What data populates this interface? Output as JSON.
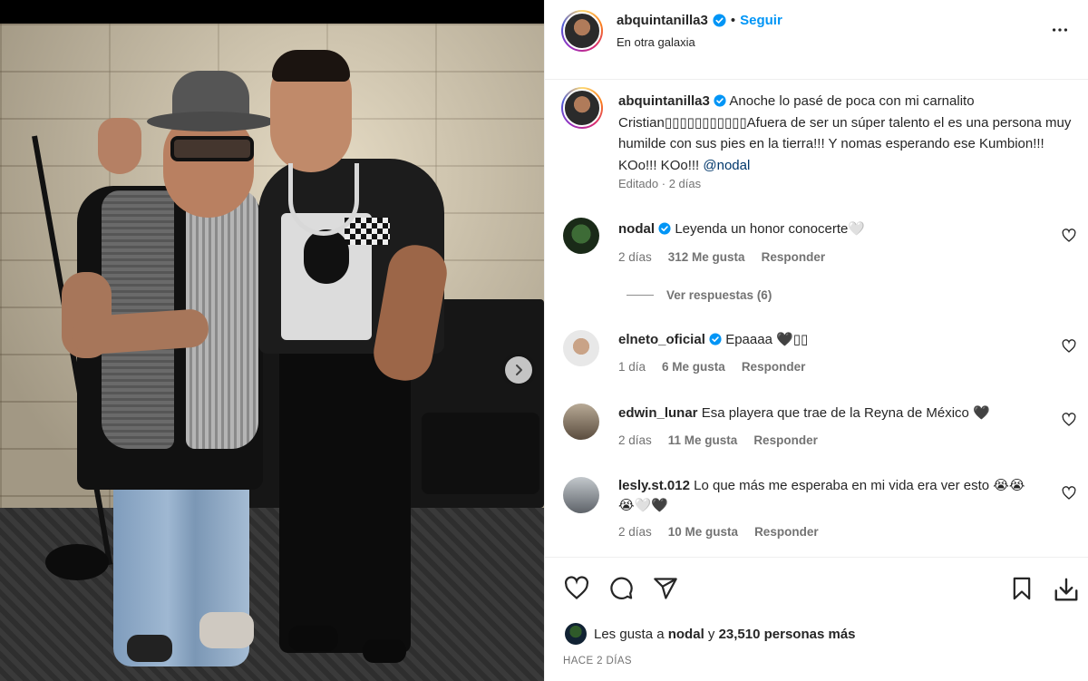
{
  "post": {
    "username": "abquintanilla3",
    "follow_label": "Seguir",
    "separator": "•",
    "location": "En otra galaxia",
    "more_icon": "more-horizontal-icon"
  },
  "caption": {
    "username": "abquintanilla3",
    "text": "Anoche lo pasé de poca con mi carnalito Cristian▯▯▯▯▯▯▯▯▯▯▯Afuera de ser un súper talento el es una persona muy humilde con sus pies en la tierra!!! Y nomas esperando ese Kumbion!!! KOo!!! KOo!!!",
    "mention": "@nodal",
    "edited": "Editado",
    "meta_separator": "·",
    "time": "2 días"
  },
  "comments": [
    {
      "username": "nodal",
      "verified": true,
      "text": "Leyenda un honor conocerte🤍",
      "time": "2 días",
      "likes": "312 Me gusta",
      "reply": "Responder",
      "avatar_color": "#2d4d2a"
    },
    {
      "username": "elneto_oficial",
      "verified": true,
      "text": "Epaaaa 🖤▯▯",
      "time": "1 día",
      "likes": "6 Me gusta",
      "reply": "Responder",
      "avatar_color": "#cfcfcf"
    },
    {
      "username": "edwin_lunar",
      "verified": false,
      "text": "Esa playera que trae de la Reyna de México 🖤",
      "time": "2 días",
      "likes": "11 Me gusta",
      "reply": "Responder",
      "avatar_color": "#7a6a58"
    },
    {
      "username": "lesly.st.012",
      "verified": false,
      "text": "Lo que más me esperaba en mi vida era ver esto 😭😭😭🤍🖤",
      "time": "2 días",
      "likes": "10 Me gusta",
      "reply": "Responder",
      "avatar_color": "#8a8f95"
    }
  ],
  "view_replies": "Ver respuestas (6)",
  "likes_summary": {
    "prefix": "Les gusta a",
    "user": "nodal",
    "middle": "y",
    "count": "23,510 personas más"
  },
  "timestamp": "HACE 2 DÍAS",
  "colors": {
    "accent": "#0095f6",
    "text": "#262626",
    "muted": "#737373",
    "mention": "#00376b"
  },
  "icons": [
    "heart-icon",
    "comment-icon",
    "share-icon",
    "bookmark-icon",
    "download-icon",
    "verified-badge-icon",
    "chevron-right-icon"
  ]
}
